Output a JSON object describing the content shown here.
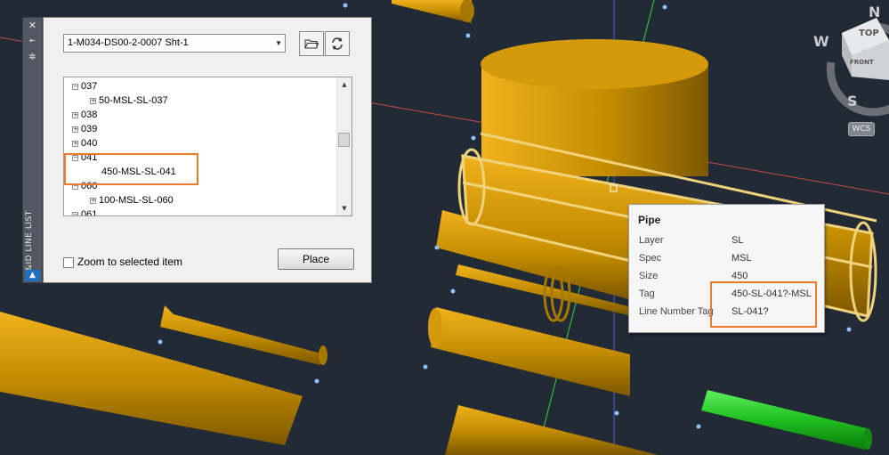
{
  "palette": {
    "title": "P&ID LINE LIST",
    "drawing_selected": "1-M034-DS00-2-0007 Sht-1",
    "tree": [
      {
        "label": "037",
        "expander": "−"
      },
      {
        "label": "50-MSL-SL-037",
        "expander": "+"
      },
      {
        "label": "038",
        "expander": "+"
      },
      {
        "label": "039",
        "expander": "+"
      },
      {
        "label": "040",
        "expander": "+"
      },
      {
        "label": "041",
        "expander": "−"
      },
      {
        "label": "450-MSL-SL-041",
        "expander": ""
      },
      {
        "label": "060",
        "expander": "−"
      },
      {
        "label": "100-MSL-SL-060",
        "expander": "+"
      },
      {
        "label": "061",
        "expander": "−"
      }
    ],
    "zoom_checkbox_label": "Zoom to selected item",
    "zoom_checked": false,
    "place_label": "Place"
  },
  "tooltip": {
    "title": "Pipe",
    "rows": [
      {
        "label": "Layer",
        "value": "SL"
      },
      {
        "label": "Spec",
        "value": "MSL"
      },
      {
        "label": "Size",
        "value": "450"
      },
      {
        "label": "Tag",
        "value": "450-SL-041?-MSL"
      },
      {
        "label": "Line Number Tag",
        "value": "SL-041?"
      }
    ]
  },
  "viewcube": {
    "top_label": "TOP",
    "front_label": "FRONT",
    "north": "N",
    "west": "W",
    "south": "S",
    "wcs_label": "WCS"
  },
  "colors": {
    "background": "#222a35",
    "pipe": "#c48d00",
    "pipe_selected": "#f0d27a",
    "pipe_green": "#1fbf1f",
    "highlight": "#ec7a2d"
  }
}
